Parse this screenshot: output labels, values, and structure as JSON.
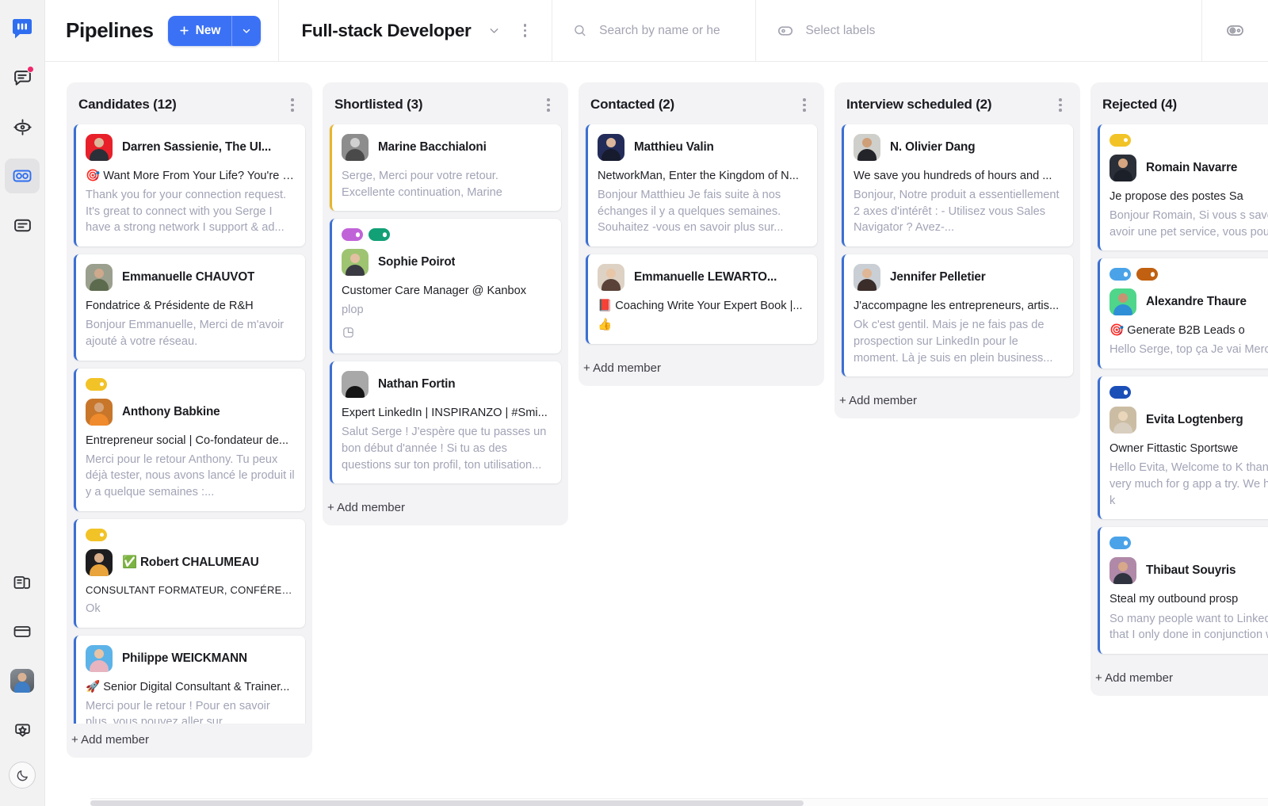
{
  "rail": {
    "logo_icon": "kanbox-logo-icon",
    "items": [
      {
        "icon": "messages-icon",
        "badge": true
      },
      {
        "icon": "target-icon",
        "badge": false
      },
      {
        "icon": "pipelines-icon",
        "badge": false,
        "active": true
      },
      {
        "icon": "notes-icon",
        "badge": false
      }
    ],
    "bottom_items": [
      {
        "icon": "library-icon"
      },
      {
        "icon": "billing-card-icon"
      },
      {
        "icon": "user-avatar-icon"
      },
      {
        "icon": "rewards-badge-icon"
      }
    ],
    "theme_toggle_icon": "moon-icon"
  },
  "topbar": {
    "app_title": "Pipelines",
    "new_button_label": "New",
    "new_button_plus_icon": "plus-icon",
    "new_button_caret_icon": "chevron-down-icon",
    "new_button_color": "#3b71f5",
    "board_title": "Full-stack Developer",
    "board_caret_icon": "chevron-down-icon",
    "board_kebab_icon": "kebab-menu-icon",
    "search_icon": "search-icon",
    "search_value": "",
    "search_placeholder": "Search by name or he",
    "labels_icon": "label-tag-icon",
    "labels_text": "Select labels",
    "right_icon": "manage-labels-icon"
  },
  "board": {
    "add_member_label": "+ Add member",
    "column_menu_icon": "ellipsis-icon",
    "columns": [
      {
        "title": "Candidates (12)",
        "cards": [
          {
            "name": "Darren Sassienie, The UI...",
            "headline": "🎯 Want More From Your Life? You're I...",
            "snippet": "Thank you for your connection request. It's great to connect with you Serge I have a strong network I support & ad...",
            "labels": [],
            "accent": "blue",
            "clamp": "clamp3",
            "avatar": {
              "bg": "#e8202a",
              "head": "#dcb79b",
              "body": "#2b2f38"
            }
          },
          {
            "name": "Emmanuelle CHAUVOT",
            "headline": "Fondatrice & Présidente de R&H",
            "snippet": "Bonjour Emmanuelle, Merci de m'avoir ajouté à votre réseau.",
            "labels": [],
            "accent": "blue",
            "clamp": "clamp2",
            "avatar": {
              "bg": "#9aa08d",
              "head": "#cfa98c",
              "body": "#5c6a4e"
            }
          },
          {
            "name": "Anthony Babkine",
            "headline": "Entrepreneur social | Co-fondateur de...",
            "snippet": "Merci pour le retour Anthony. Tu peux déjà tester, nous avons lancé le produit il y a quelque semaines :...",
            "labels": [
              "#f2c327"
            ],
            "accent": "blue",
            "clamp": "clamp3",
            "avatar": {
              "bg": "#c8762a",
              "head": "#d7a47a",
              "body": "#ef8b2c"
            }
          },
          {
            "name": "✅ Robert CHALUMEAU",
            "headline": "CONSULTANT FORMATEUR, CONFÉRENCIER ...",
            "headline_caps": true,
            "snippet": "Ok",
            "labels": [
              "#f2c327"
            ],
            "accent": "blue",
            "clamp": "clamp1",
            "avatar": {
              "bg": "#1d1d20",
              "head": "#d8ae8b",
              "body": "#e8a33a"
            }
          },
          {
            "name": "Philippe WEICKMANN",
            "headline": "🚀 Senior Digital Consultant & Trainer...",
            "snippet": "Merci pour le retour ! Pour en savoir plus, vous pouvez aller sur https://www.kanbox.io/",
            "labels": [],
            "accent": "blue",
            "clamp": "clamp3",
            "avatar": {
              "bg": "#5cb3e8",
              "head": "#e8c4a6",
              "body": "#e8b4bf"
            }
          }
        ]
      },
      {
        "title": "Shortlisted (3)",
        "cards": [
          {
            "name": "Marine Bacchialoni",
            "headline": "",
            "snippet": "Serge, Merci pour votre retour. Excellente continuation, Marine",
            "labels": [],
            "accent": "amber",
            "clamp": "clamp2",
            "avatar": {
              "bg": "#8d8d8d",
              "head": "#d0d0d0",
              "body": "#4a4a4a"
            }
          },
          {
            "name": "Sophie Poirot",
            "headline": "Customer Care Manager @ Kanbox",
            "snippet": "plop",
            "labels": [
              "#c163d8",
              "#12a077"
            ],
            "accent": "blue",
            "note_icon": "note-icon",
            "clamp": "clamp1",
            "avatar": {
              "bg": "#9ec472",
              "head": "#e3c0a2",
              "body": "#3a3a42"
            }
          },
          {
            "name": "Nathan Fortin",
            "headline": "Expert LinkedIn | INSPIRANZO | #Smi...",
            "snippet": "Salut Serge ! J'espère que tu passes un bon début d'année ! Si tu as des questions sur ton profil, ton utilisation...",
            "labels": [],
            "accent": "blue",
            "clamp": "clamp3",
            "avatar": {
              "bg": "#a8a8a8",
              "head": "#c6a храbbb",
              "body": "#161616"
            }
          }
        ]
      },
      {
        "title": "Contacted (2)",
        "cards": [
          {
            "name": "Matthieu Valin",
            "headline": "NetworkMan, Enter the Kingdom of N...",
            "snippet": "Bonjour Matthieu Je fais suite à nos échanges il y a quelques semaines. Souhaitez -vous en savoir plus sur...",
            "labels": [],
            "accent": "blue",
            "clamp": "clamp3",
            "avatar": {
              "bg": "#232c58",
              "head": "#dcb79b",
              "body": "#171b2e"
            }
          },
          {
            "name": "Emmanuelle LEWARTO...",
            "headline": "📕 Coaching Write Your Expert Book |...",
            "snippet": "👍",
            "labels": [],
            "accent": "blue",
            "clamp": "clamp1",
            "avatar": {
              "bg": "#ddd2c4",
              "head": "#e8c6a8",
              "body": "#5a4238"
            }
          }
        ]
      },
      {
        "title": "Interview scheduled (2)",
        "cards": [
          {
            "name": "N. Olivier Dang",
            "headline": "We save you hundreds of hours and ...",
            "snippet": "Bonjour, Notre produit a essentiellement 2 axes d'intérêt : - Utilisez vous Sales Navigator ? Avez-...",
            "labels": [],
            "accent": "blue",
            "clamp": "clamp3",
            "avatar": {
              "bg": "#cfcfcb",
              "head": "#cf9f78",
              "body": "#23242a"
            }
          },
          {
            "name": "Jennifer Pelletier",
            "headline": "J'accompagne les entrepreneurs, artis...",
            "snippet": "Ok c'est gentil. Mais je ne fais pas de prospection sur LinkedIn pour le moment. Là je suis en plein business...",
            "labels": [],
            "accent": "blue",
            "clamp": "clamp3",
            "avatar": {
              "bg": "#c9cfd4",
              "head": "#e0b796",
              "body": "#3a2d2a"
            }
          }
        ]
      },
      {
        "title": "Rejected (4)",
        "cards": [
          {
            "name": "Romain Navarre",
            "headline": "Je propose des postes Sa",
            "snippet": "Bonjour Romain, Si vous s savoir plus, avoir une pet service, vous pouvez rése",
            "labels": [
              "#f2c327"
            ],
            "accent": "blue",
            "clamp": "clamp3",
            "avatar": {
              "bg": "#2a2f38",
              "head": "#d6a680",
              "body": "#1c2029"
            }
          },
          {
            "name": "Alexandre Thaure",
            "headline": "🎯 Generate B2B Leads o",
            "snippet": "Hello Serge,  top ça Je vai Merci à toi",
            "labels": [
              "#4aa3e8",
              "#c06010"
            ],
            "accent": "blue",
            "clamp": "clamp2",
            "avatar": {
              "bg": "#4fd68a",
              "head": "#c99373",
              "body": "#2f8fd6"
            }
          },
          {
            "name": "Evita Logtenberg",
            "headline": "Owner Fittastic Sportswe",
            "snippet": "Hello Evita, Welcome to K thank you very much for g app a try. We hope that k",
            "labels": [
              "#1b4fb8"
            ],
            "accent": "blue",
            "clamp": "clamp3",
            "avatar": {
              "bg": "#cbbda4",
              "head": "#ead7bb",
              "body": "#d9cfc0"
            }
          },
          {
            "name": "Thibaut Souyris",
            "headline": "Steal my outbound prosp",
            "snippet": "So many people want to LinkedIn posts that I only done in conjunction with",
            "labels": [
              "#4aa3e8"
            ],
            "accent": "blue",
            "clamp": "clamp3",
            "avatar": {
              "bg": "#b089a8",
              "head": "#d8a88a",
              "body": "#2f3340"
            }
          }
        ]
      }
    ]
  }
}
